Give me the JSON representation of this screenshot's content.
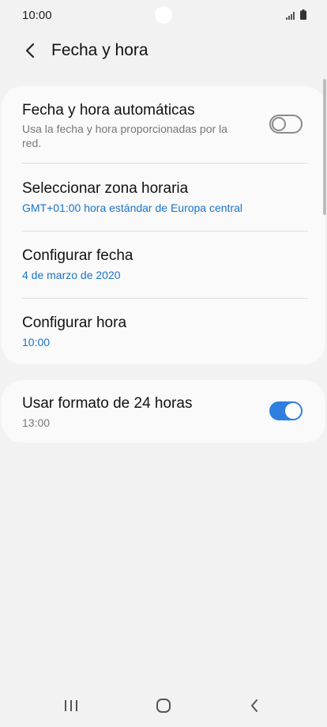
{
  "status_bar": {
    "time": "10:00"
  },
  "header": {
    "title": "Fecha y hora"
  },
  "settings": {
    "auto_datetime": {
      "title": "Fecha y hora automáticas",
      "subtitle_line1": "Usa la fecha y hora proporcionadas por la",
      "subtitle_line2": "red.",
      "enabled": false
    },
    "timezone": {
      "title": "Seleccionar zona horaria",
      "value": "GMT+01:00 hora estándar de Europa central"
    },
    "date": {
      "title": "Configurar fecha",
      "value": "4 de marzo de 2020"
    },
    "time": {
      "title": "Configurar hora",
      "value": "10:00"
    },
    "format_24h": {
      "title": "Usar formato de 24 horas",
      "value": "13:00",
      "enabled": true
    }
  },
  "colors": {
    "accent": "#2f7fe0",
    "link_blue": "#1a73c9",
    "background": "#f2f2f2"
  }
}
